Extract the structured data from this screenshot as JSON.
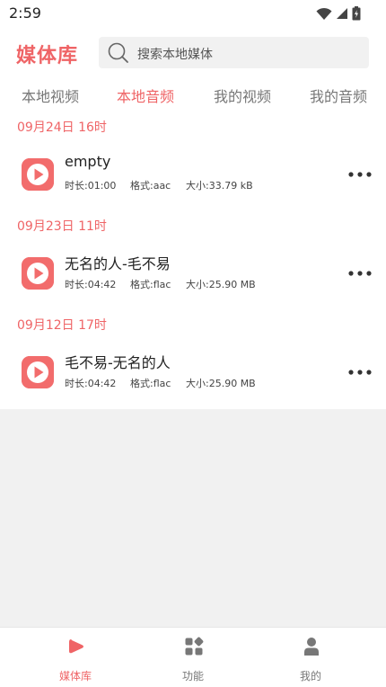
{
  "status_bar": {
    "time": "2:59"
  },
  "header": {
    "title": "媒体库",
    "search_placeholder": "搜索本地媒体"
  },
  "tabs": [
    {
      "label": "本地视频",
      "active": false
    },
    {
      "label": "本地音频",
      "active": true
    },
    {
      "label": "我的视频",
      "active": false
    },
    {
      "label": "我的音频",
      "active": false
    }
  ],
  "groups": [
    {
      "date": "09月24日  16时",
      "item": {
        "title": "empty",
        "duration": "时长:01:00",
        "format": "格式:aac",
        "size": "大小:33.79 kB"
      }
    },
    {
      "date": "09月23日  11时",
      "item": {
        "title": "无名的人-毛不易",
        "duration": "时长:04:42",
        "format": "格式:flac",
        "size": "大小:25.90 MB"
      }
    },
    {
      "date": "09月12日  17时",
      "item": {
        "title": "毛不易-无名的人",
        "duration": "时长:04:42",
        "format": "格式:flac",
        "size": "大小:25.90 MB"
      }
    }
  ],
  "bottom_nav": [
    {
      "label": "媒体库",
      "icon": "media-library-icon",
      "active": true
    },
    {
      "label": "功能",
      "icon": "functions-grid-icon",
      "active": false
    },
    {
      "label": "我的",
      "icon": "profile-icon",
      "active": false
    }
  ],
  "colors": {
    "accent": "#ef6466",
    "play_button": "#f26c6c",
    "background": "#f1f1f1"
  }
}
